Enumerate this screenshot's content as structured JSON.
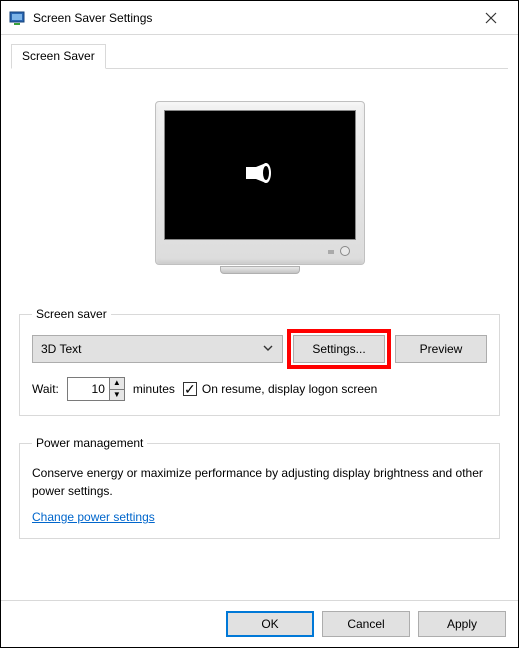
{
  "window": {
    "title": "Screen Saver Settings"
  },
  "tab": {
    "label": "Screen Saver"
  },
  "groups": {
    "screensaver": {
      "legend": "Screen saver"
    },
    "power": {
      "legend": "Power management",
      "text": "Conserve energy or maximize performance by adjusting display brightness and other power settings.",
      "link": "Change power settings"
    }
  },
  "dropdown": {
    "selected": "3D Text"
  },
  "buttons": {
    "settings": "Settings...",
    "preview": "Preview",
    "ok": "OK",
    "cancel": "Cancel",
    "apply": "Apply"
  },
  "wait": {
    "label": "Wait:",
    "value": "10",
    "unit": "minutes"
  },
  "checkbox": {
    "checked": "✓",
    "label": "On resume, display logon screen"
  }
}
